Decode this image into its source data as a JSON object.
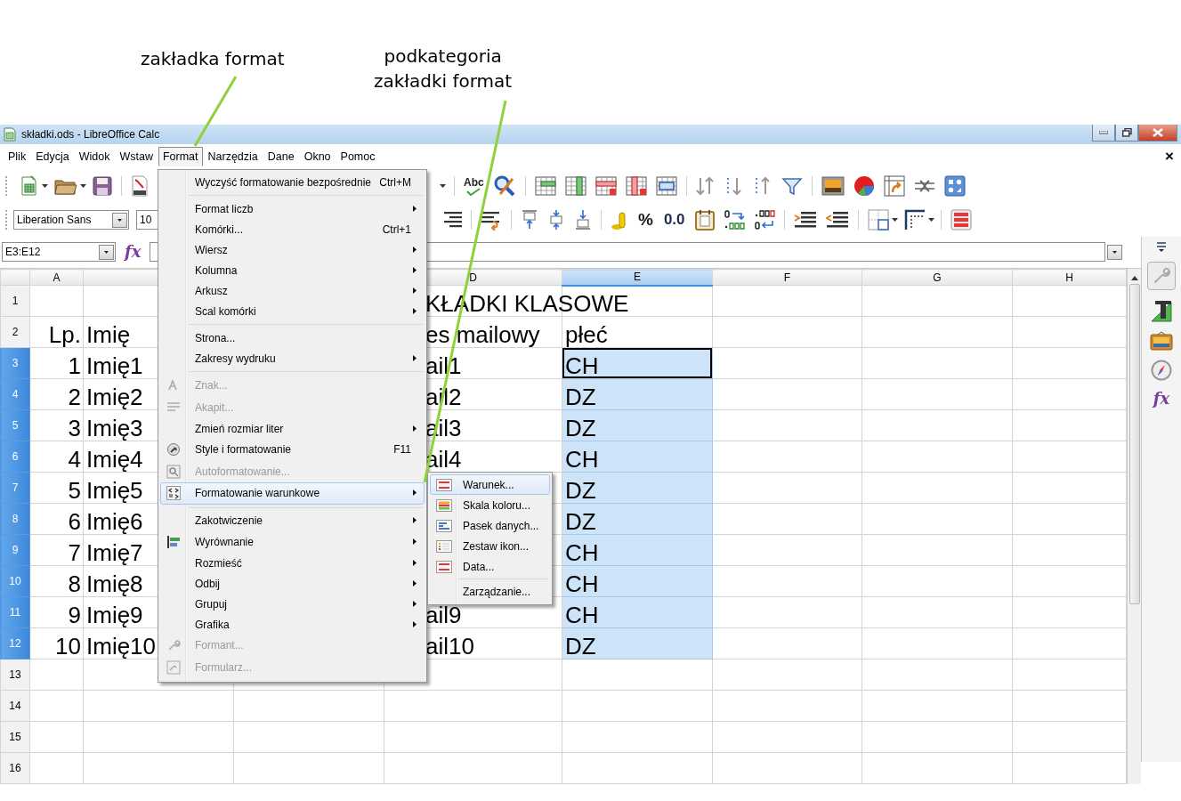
{
  "annotations": [
    {
      "text": "zakładka format"
    },
    {
      "text": "podkategoria\nzakładki format"
    }
  ],
  "window": {
    "title": "składki.ods - LibreOffice Calc"
  },
  "menu_bar": {
    "items": [
      {
        "label": "Plik",
        "selected": false
      },
      {
        "label": "Edycja",
        "selected": false
      },
      {
        "label": "Widok",
        "selected": false
      },
      {
        "label": "Wstaw",
        "selected": false
      },
      {
        "label": "Format",
        "selected": true
      },
      {
        "label": "Narzędzia",
        "selected": false
      },
      {
        "label": "Dane",
        "selected": false
      },
      {
        "label": "Okno",
        "selected": false
      },
      {
        "label": "Pomoc",
        "selected": false
      }
    ],
    "close_glyph": "×"
  },
  "standard_toolbar": {
    "spellcheck_label": "Abc"
  },
  "formatting_toolbar": {
    "font_name": "Liberation Sans",
    "font_size": "10",
    "percent_label": "%",
    "decimal_label": "0.0"
  },
  "formula_bar": {
    "name_box": "E3:E12",
    "function_glyph": "fx"
  },
  "sidebar": {
    "function_glyph": "fx"
  },
  "sheet": {
    "columns": [
      {
        "kind": "header",
        "label": "A",
        "selected": false
      },
      {
        "kind": "covered"
      },
      {
        "kind": "covered"
      },
      {
        "kind": "header",
        "label": "D",
        "selected": false
      },
      {
        "kind": "header",
        "label": "E",
        "selected": true
      },
      {
        "kind": "header",
        "label": "F",
        "selected": false
      },
      {
        "kind": "header",
        "label": "G",
        "selected": false
      },
      {
        "kind": "header",
        "label": "H",
        "selected": false
      }
    ],
    "rows": [
      {
        "number": "1",
        "selected": false,
        "cursor": false,
        "cells": {
          "column_4": "KŁADKI KLASOWE"
        }
      },
      {
        "number": "2",
        "selected": false,
        "cursor": false,
        "cells": {
          "column_1": "Lp.",
          "column_2": "Imię",
          "column_4": "es mailowy",
          "column_5": "płeć"
        }
      },
      {
        "number": "3",
        "selected": true,
        "cursor": true,
        "cells": {
          "column_1": "1",
          "column_2": "Imię1",
          "column_4": "ail1",
          "column_5": "CH"
        }
      },
      {
        "number": "4",
        "selected": true,
        "cursor": false,
        "cells": {
          "column_1": "2",
          "column_2": "Imię2",
          "column_4": "ail2",
          "column_5": "DZ"
        }
      },
      {
        "number": "5",
        "selected": true,
        "cursor": false,
        "cells": {
          "column_1": "3",
          "column_2": "Imię3",
          "column_4": "ail3",
          "column_5": "DZ"
        }
      },
      {
        "number": "6",
        "selected": true,
        "cursor": false,
        "cells": {
          "column_1": "4",
          "column_2": "Imię4",
          "column_4": "ail4",
          "column_5": "CH"
        }
      },
      {
        "number": "7",
        "selected": true,
        "cursor": false,
        "cells": {
          "column_1": "5",
          "column_2": "Imię5",
          "column_5": "DZ"
        }
      },
      {
        "number": "8",
        "selected": true,
        "cursor": false,
        "cells": {
          "column_1": "6",
          "column_2": "Imię6",
          "column_5": "DZ"
        }
      },
      {
        "number": "9",
        "selected": true,
        "cursor": false,
        "cells": {
          "column_1": "7",
          "column_2": "Imię7",
          "column_5": "CH"
        }
      },
      {
        "number": "10",
        "selected": true,
        "cursor": false,
        "cells": {
          "column_1": "8",
          "column_2": "Imię8",
          "column_5": "CH"
        }
      },
      {
        "number": "11",
        "selected": true,
        "cursor": false,
        "cells": {
          "column_1": "9",
          "column_2": "Imię9",
          "column_4": "ail9",
          "column_5": "CH"
        }
      },
      {
        "number": "12",
        "selected": true,
        "cursor": false,
        "cells": {
          "column_1": "10",
          "column_2": "Imię10",
          "column_4": "ail10",
          "column_5": "DZ"
        }
      },
      {
        "number": "13",
        "selected": false,
        "cursor": false
      },
      {
        "number": "14",
        "selected": false,
        "cursor": false
      },
      {
        "number": "15",
        "selected": false,
        "cursor": false
      },
      {
        "number": "16",
        "selected": false,
        "cursor": false
      }
    ]
  },
  "format_menu": {
    "items": [
      {
        "kind": "item",
        "label": "Wyczyść formatowanie bezpośrednie",
        "shortcut": "Ctrl+M",
        "submenu": false,
        "disabled": false,
        "selected": false
      },
      {
        "kind": "separator"
      },
      {
        "kind": "item",
        "label": "Format liczb",
        "submenu": true,
        "disabled": false,
        "selected": false
      },
      {
        "kind": "item",
        "label": "Komórki...",
        "shortcut": "Ctrl+1",
        "submenu": false,
        "disabled": false,
        "selected": false
      },
      {
        "kind": "item",
        "label": "Wiersz",
        "submenu": true,
        "disabled": false,
        "selected": false
      },
      {
        "kind": "item",
        "label": "Kolumna",
        "submenu": true,
        "disabled": false,
        "selected": false
      },
      {
        "kind": "item",
        "label": "Arkusz",
        "submenu": true,
        "disabled": false,
        "selected": false
      },
      {
        "kind": "item",
        "label": "Scal komórki",
        "submenu": true,
        "disabled": false,
        "selected": false
      },
      {
        "kind": "separator"
      },
      {
        "kind": "item",
        "label": "Strona...",
        "submenu": false,
        "disabled": false,
        "selected": false
      },
      {
        "kind": "item",
        "label": "Zakresy wydruku",
        "submenu": true,
        "disabled": false,
        "selected": false
      },
      {
        "kind": "separator"
      },
      {
        "kind": "item",
        "label": "Znak...",
        "submenu": false,
        "disabled": true,
        "selected": false
      },
      {
        "kind": "item",
        "label": "Akapit...",
        "submenu": false,
        "disabled": true,
        "selected": false
      },
      {
        "kind": "item",
        "label": "Zmień rozmiar liter",
        "submenu": true,
        "disabled": false,
        "selected": false
      },
      {
        "kind": "item",
        "label": "Style i formatowanie",
        "shortcut": "F11",
        "submenu": false,
        "disabled": false,
        "selected": false
      },
      {
        "kind": "item",
        "label": "Autoformatowanie...",
        "submenu": false,
        "disabled": true,
        "selected": false
      },
      {
        "kind": "item",
        "label": "Formatowanie warunkowe",
        "submenu": true,
        "disabled": false,
        "selected": true
      },
      {
        "kind": "separator"
      },
      {
        "kind": "item",
        "label": "Zakotwiczenie",
        "submenu": true,
        "disabled": false,
        "selected": false
      },
      {
        "kind": "item",
        "label": "Wyrównanie",
        "submenu": true,
        "disabled": false,
        "selected": false
      },
      {
        "kind": "item",
        "label": "Rozmieść",
        "submenu": true,
        "disabled": false,
        "selected": false
      },
      {
        "kind": "item",
        "label": "Odbij",
        "submenu": true,
        "disabled": false,
        "selected": false
      },
      {
        "kind": "item",
        "label": "Grupuj",
        "submenu": true,
        "disabled": false,
        "selected": false
      },
      {
        "kind": "item",
        "label": "Grafika",
        "submenu": true,
        "disabled": false,
        "selected": false
      },
      {
        "kind": "item",
        "label": "Formant...",
        "submenu": false,
        "disabled": true,
        "selected": false
      },
      {
        "kind": "item",
        "label": "Formularz...",
        "submenu": false,
        "disabled": true,
        "selected": false
      }
    ]
  },
  "conditional_submenu": {
    "items": [
      {
        "kind": "item",
        "label": "Warunek...",
        "selected": true
      },
      {
        "kind": "item",
        "label": "Skala koloru...",
        "selected": false
      },
      {
        "kind": "item",
        "label": "Pasek danych...",
        "selected": false
      },
      {
        "kind": "item",
        "label": "Zestaw ikon...",
        "selected": false
      },
      {
        "kind": "item",
        "label": "Data...",
        "selected": false
      },
      {
        "kind": "separator"
      },
      {
        "kind": "item",
        "label": "Zarządzanie...",
        "selected": false
      }
    ]
  }
}
